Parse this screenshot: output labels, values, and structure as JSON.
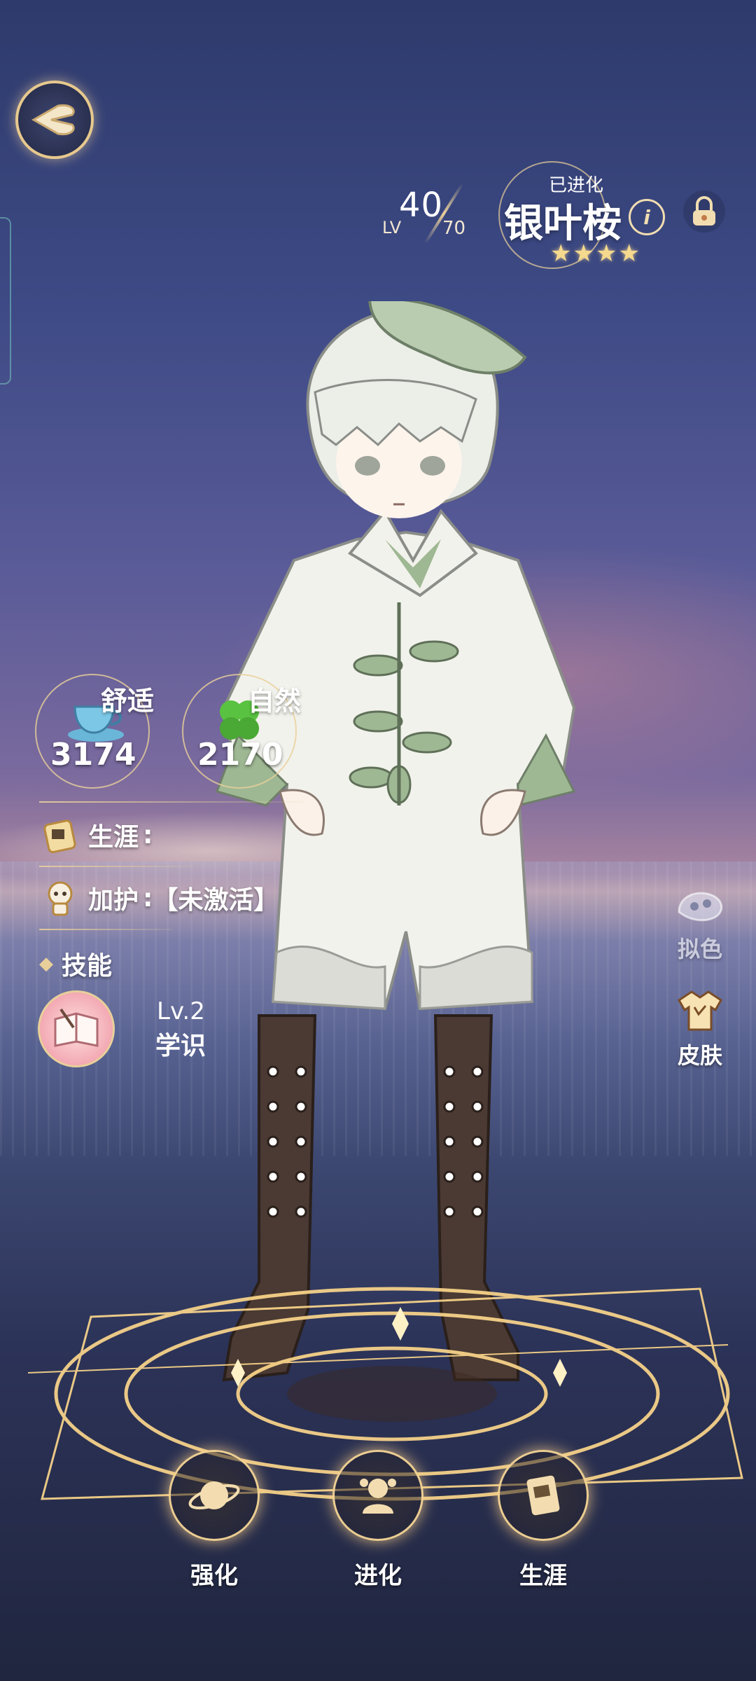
{
  "header": {
    "level_prefix": "LV",
    "level_current": "40",
    "level_max": "70",
    "status": "已进化",
    "character_name": "银叶桉",
    "rarity_stars": "★★★★",
    "info_icon": "info-icon",
    "lock_icon": "lock-icon",
    "back_icon": "back-wing-icon"
  },
  "stats": [
    {
      "label": "舒适",
      "value": "3174",
      "icon": "teacup-icon"
    },
    {
      "label": "自然",
      "value": "2170",
      "icon": "clover-icon"
    }
  ],
  "info_rows": {
    "career_label": "生涯",
    "guardian_label": "加护",
    "guardian_value": "【未激活】",
    "skills_label": "技能"
  },
  "skill": {
    "level": "Lv.2",
    "name": "学识",
    "icon": "book-icon"
  },
  "right_menu": {
    "dye_label": "拟色",
    "skin_label": "皮肤"
  },
  "bottom_menu": [
    {
      "label": "强化",
      "icon": "planet-icon"
    },
    {
      "label": "进化",
      "icon": "evolve-icon"
    },
    {
      "label": "生涯",
      "icon": "career-book-icon"
    }
  ],
  "colors": {
    "gold": "#e8cf9a",
    "star": "#f4d98e",
    "coat": "#f2f2ec",
    "leaf_green": "#9fb894",
    "boot_brown": "#4a3a33"
  }
}
